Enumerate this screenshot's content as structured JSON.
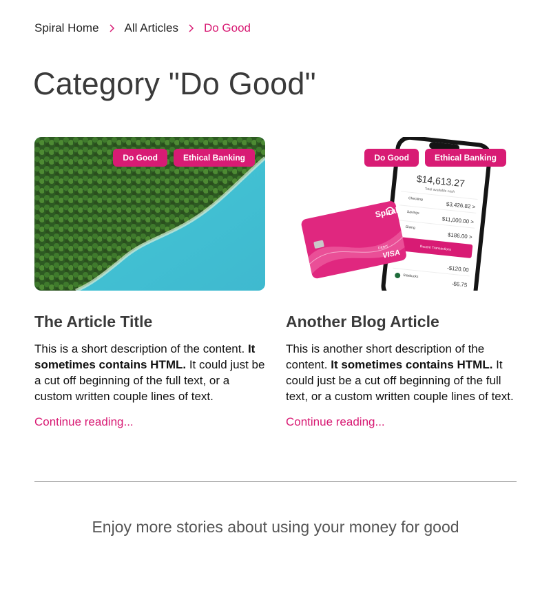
{
  "breadcrumb": {
    "home": "Spiral Home",
    "all": "All Articles",
    "current": "Do Good"
  },
  "page_title": "Category \"Do Good\"",
  "articles": [
    {
      "title": "The Article Title",
      "tags": [
        "Do Good",
        "Ethical Banking"
      ],
      "desc_start": "This is a short description of the content. ",
      "desc_bold": "It sometimes contains HTML.",
      "desc_end": " It could just be a cut off beginning of the full text, or a custom written couple lines of text.",
      "link": "Continue reading..."
    },
    {
      "title": "Another Blog Article",
      "tags": [
        "Do Good",
        "Ethical Banking"
      ],
      "desc_start": "This is another short description of the content. ",
      "desc_bold": "It sometimes contains HTML.",
      "desc_end": " It could just be a cut off beginning of the full text, or a custom written couple lines of text.",
      "link": "Continue reading..."
    }
  ],
  "phone": {
    "balance": "$14,613.27",
    "balance_label": "Total available cash",
    "rows": [
      {
        "label": "Checking",
        "amount": "$3,426.82 >"
      },
      {
        "label": "Savings",
        "amount": "$11,000.00 >"
      },
      {
        "label": "Giving",
        "amount": "$186.00 >"
      },
      {
        "label": "",
        "amount": "-$120.00"
      },
      {
        "label": "Starbucks",
        "amount": "-$6.75"
      }
    ],
    "recent": "Recent Transactions"
  },
  "card": {
    "brand": "Spiral",
    "type": "DEBIT",
    "network": "VISA"
  },
  "tagline": "Enjoy more stories about using your money for good",
  "colors": {
    "accent": "#d81b74",
    "text": "#3a3a3a",
    "divider": "#8f8f8f"
  }
}
